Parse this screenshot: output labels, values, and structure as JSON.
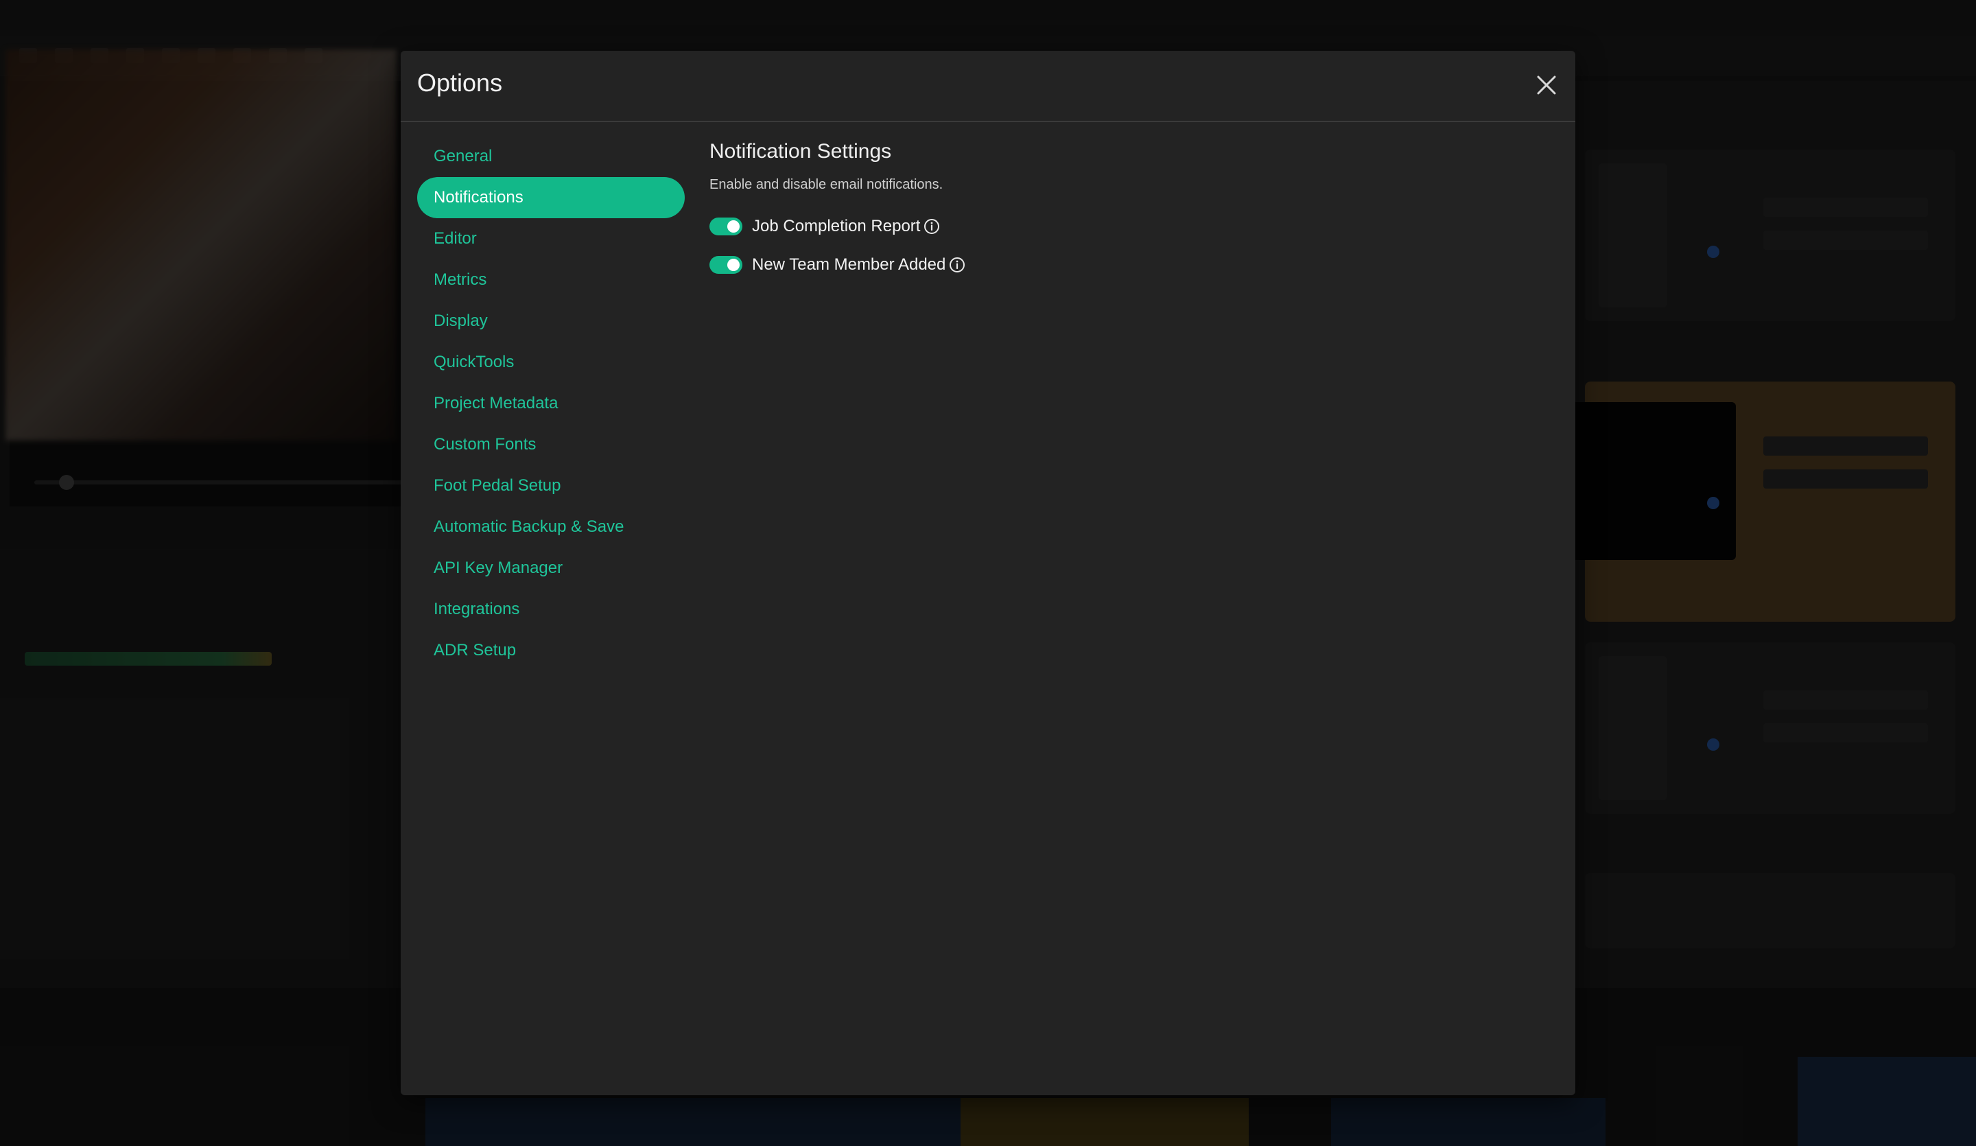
{
  "dialog": {
    "title": "Options"
  },
  "nav": {
    "items": [
      {
        "label": "General"
      },
      {
        "label": "Notifications"
      },
      {
        "label": "Editor"
      },
      {
        "label": "Metrics"
      },
      {
        "label": "Display"
      },
      {
        "label": "QuickTools"
      },
      {
        "label": "Project Metadata"
      },
      {
        "label": "Custom Fonts"
      },
      {
        "label": "Foot Pedal Setup"
      },
      {
        "label": "Automatic Backup & Save"
      },
      {
        "label": "API Key Manager"
      },
      {
        "label": "Integrations"
      },
      {
        "label": "ADR Setup"
      }
    ],
    "active": "Notifications"
  },
  "notifications": {
    "heading": "Notification Settings",
    "description": "Enable and disable email notifications.",
    "toggles": [
      {
        "label": "Job Completion Report",
        "enabled": true
      },
      {
        "label": "New Team Member Added",
        "enabled": true
      }
    ]
  },
  "colors": {
    "accent": "#12b889",
    "accent_text": "#1fc59a",
    "dialog_bg": "#232323",
    "backdrop": "rgba(0,0,0,0.55)"
  },
  "icons": {
    "close": "close-icon",
    "info": "info-icon"
  }
}
